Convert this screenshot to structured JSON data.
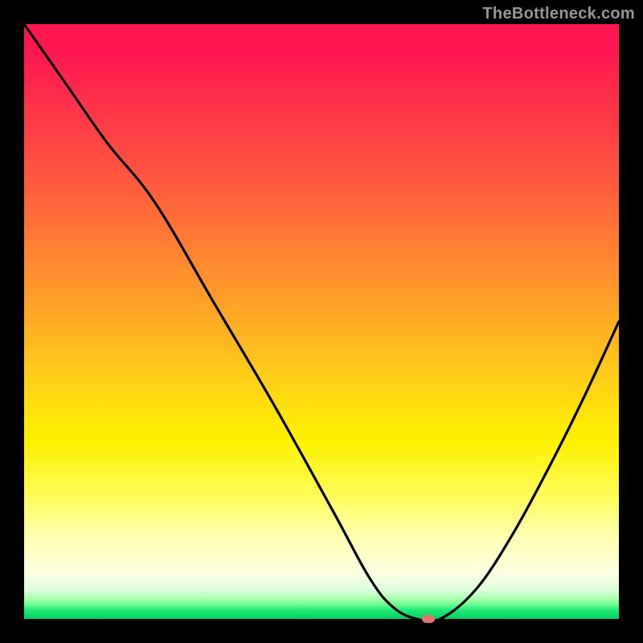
{
  "watermark": "TheBottleneck.com",
  "colors": {
    "background": "#000000",
    "curve": "#000000",
    "marker": "#e2756b",
    "watermark_text": "#979797"
  },
  "chart_data": {
    "type": "line",
    "title": "",
    "xlabel": "",
    "ylabel": "",
    "xlim": [
      0,
      100
    ],
    "ylim": [
      0,
      100
    ],
    "series": [
      {
        "name": "bottleneck-curve",
        "x": [
          0,
          7,
          14,
          22,
          32,
          42,
          52,
          58,
          62,
          66,
          70,
          76,
          82,
          88,
          94,
          100
        ],
        "values": [
          100,
          90,
          80,
          70,
          53,
          36,
          18,
          7,
          2,
          0,
          0,
          5,
          14,
          25,
          37,
          50
        ]
      }
    ],
    "marker": {
      "x": 68,
      "y": 0,
      "label": "optimal-point"
    },
    "annotations": []
  }
}
